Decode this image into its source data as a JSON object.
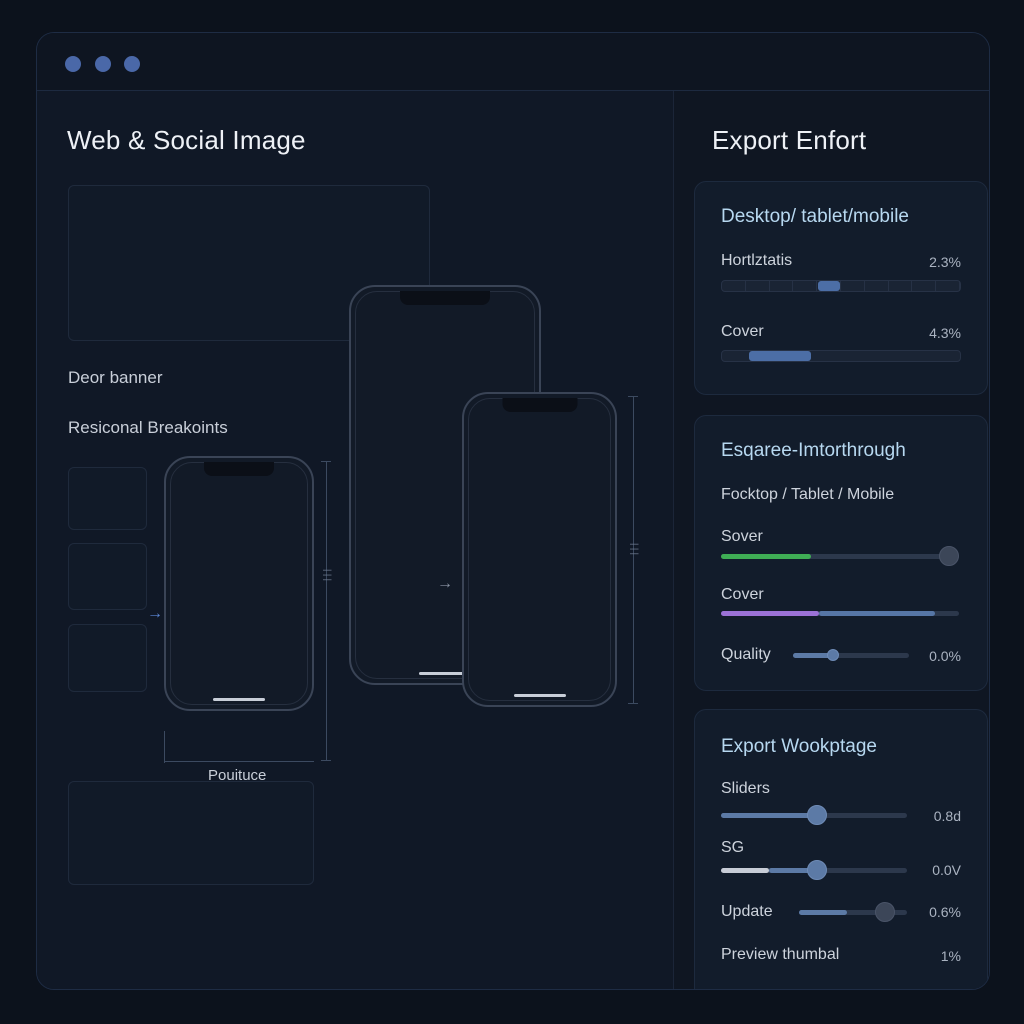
{
  "left": {
    "title": "Web & Social Image",
    "decor_banner": "Deor banner",
    "breakpoints_label": "Resiconal Breakoints",
    "phone_caption": "Pouituce"
  },
  "right": {
    "title": "Export Enfort",
    "card1": {
      "title": "Desktop/ tablet/mobile",
      "row1": {
        "label": "Hortlztatis",
        "value": "2.3%",
        "level": 0.23
      },
      "row2": {
        "label": "Cover",
        "value": "4.3%",
        "level": 0.43
      }
    },
    "card2": {
      "title": "Esqaree-Imtorthrough",
      "subtitle": "Focktop / Tablet / Mobile",
      "row1": {
        "label": "Sover",
        "color": "#3fae55"
      },
      "row2": {
        "label": "Cover",
        "color": "#9b72d6"
      },
      "row3": {
        "label": "Quality",
        "value": "0.0%"
      }
    },
    "card3": {
      "title": "Export Wookptage",
      "row1": {
        "label": "Sliders",
        "value": "0.8d"
      },
      "row2": {
        "label": "SG",
        "value": "0.0V"
      },
      "row3": {
        "label": "Update",
        "value": "0.6%"
      },
      "row4": {
        "label": "Preview thumbal",
        "value": "1%"
      }
    }
  },
  "colors": {
    "accent": "#4a68a8",
    "slider": "#5c7aa6",
    "green": "#3fae55",
    "purple": "#9b72d6"
  }
}
